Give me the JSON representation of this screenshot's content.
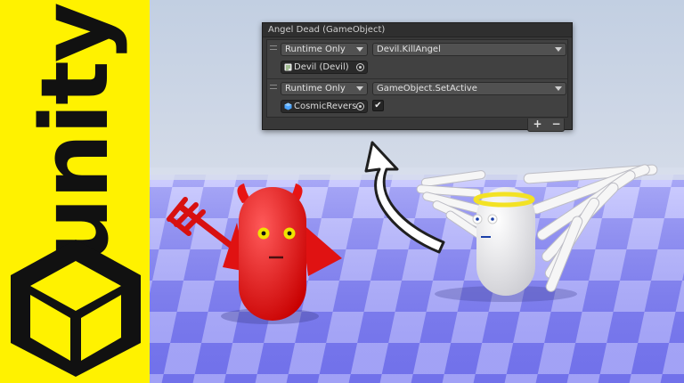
{
  "brand": {
    "wordmark": "unity",
    "colors": {
      "strip": "#fff200",
      "ink": "#111111"
    }
  },
  "scene": {
    "characters": [
      "devil",
      "angel"
    ],
    "arrow": "curved-arrow-up",
    "colors": {
      "sky": "#c7d3e6",
      "floor_light": "#b7b7ff",
      "floor_dark": "#6f6ff0",
      "devil": "#ff1f1f",
      "angel": "#f4f4f4",
      "halo": "#f3e224"
    }
  },
  "event_panel": {
    "title": "Angel Dead (GameObject)",
    "entries": [
      {
        "mode": "Runtime Only",
        "function": "Devil.KillAngel",
        "object": "Devil (Devil)",
        "object_icon": "script-icon"
      },
      {
        "mode": "Runtime Only",
        "function": "GameObject.SetActive",
        "object": "CosmicReversa",
        "object_icon": "gameobject-icon",
        "checkbox": "✔"
      }
    ],
    "add_label": "+",
    "remove_label": "−",
    "colors": {
      "panel": "#383838",
      "field": "#515151",
      "text": "#d2d2d2"
    }
  }
}
